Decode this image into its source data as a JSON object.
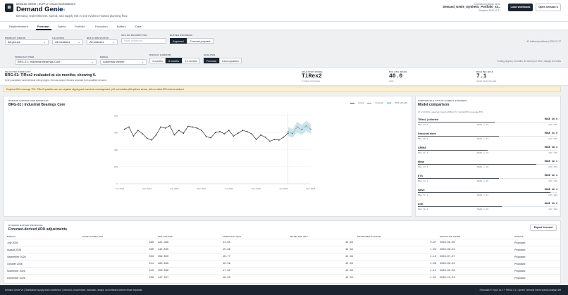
{
  "header": {
    "eyebrow": "DEMAND GENIE | SUPPLY CHAIN WORKBENCH",
    "title": "Demand Genie",
    "version": "VERSION 6",
    "subtitle": "Demand, replenishment, spend, and supply risk in one evidence-based planning flow.",
    "snapshot_label": "Embedded synthetic demo",
    "snapshot_file": "Demand_Genie_Synthetic_Portfolio_v3...",
    "snapshot_date": "Snapshot 2026-07-27",
    "load_button": "Load workbook",
    "open_button": "Open version 4"
  },
  "tabs": [
    "Replenishment",
    "Forecast",
    "Spend",
    "Portfolio",
    "Execution",
    "Buffers",
    "Data"
  ],
  "active_tab": "Forecast",
  "filters": {
    "product_group_label": "PRODUCT GROUP",
    "product_group_value": "All groups",
    "location_label": "LOCATION",
    "location_value": "All locations",
    "netflow_label": "NET-FLOW STATUS",
    "netflow_value": "All statuses",
    "sku_label": "SKU OR DESCRIPTION",
    "sku_placeholder": "Filter positions",
    "buffer_label": "BUFFER ROUNDING",
    "buffer_options": [
      "Approved",
      "Forecast proposal"
    ],
    "buffered_count": "40 buffered positions | 2026-07-27"
  },
  "forecast_controls": {
    "item_label": "FORECAST ITEM",
    "item_value": "BRG-01 | Industrial Bearings Core",
    "model_label": "MODEL",
    "model_value": "Automatic winner",
    "horizon_label": "DISPLAY HORIZON",
    "horizon_options": [
      "3 months",
      "6 months",
      "12 months"
    ],
    "analysis_label": "ANALYSIS",
    "analysis_options": [
      "Forecast",
      "Decomposition"
    ],
    "origins_info": "7 rolling origins | 6 months, 40 series per SKU | display 6 months"
  },
  "selected": {
    "label": "SELECTED FORECAST",
    "headline": "BRG-01: TiRex2 evaluated at six months; showing 6.",
    "detail": "Every candidate used identical rolling origins; forecast output remains separate from qualified demand.",
    "model_label": "SELECTED MODEL",
    "model_value": "TiRex2",
    "model_sub": "7 origins | 40 series",
    "mase_label": "ROLLING MASE",
    "mase_value": "40.0",
    "mase_sub": "units",
    "bias_label": "ROLLING BIAS",
    "bias_value": "7.1",
    "bias_sub": "actual minus forecast"
  },
  "notice": "Empirical 80% coverage 79%. TiRex2 quantiles use non-negative clipping and monotone rearrangement; p10 and median p50 split are shown, with no native 80% interval claimed.",
  "chart_panel": {
    "label": "DEMAND HISTORY AND FORECAST",
    "title": "BRG-01 | Industrial Bearings Core",
    "legend_actual": "Actual",
    "legend_forecast": "Forecast",
    "legend_band": "80% p10-p90"
  },
  "chart_data": {
    "type": "line",
    "title": "BRG-01 | Industrial Bearings Core",
    "xlabel": "",
    "ylabel": "",
    "x_ticks": [
      "Jun 2023",
      "Dec 2023",
      "Jun 2024",
      "Dec 2024",
      "Jun 2025",
      "Dec 2025",
      "Jun 2026",
      "Dec 2026"
    ],
    "y_ticks": [
      0,
      150,
      300,
      450,
      600
    ],
    "ylim": [
      0,
      620
    ],
    "series": [
      {
        "name": "Actual",
        "x": [
          "2023-07",
          "2023-08",
          "2023-09",
          "2023-10",
          "2023-11",
          "2023-12",
          "2024-01",
          "2024-02",
          "2024-03",
          "2024-04",
          "2024-05",
          "2024-06",
          "2024-07",
          "2024-08",
          "2024-09",
          "2024-10",
          "2024-11",
          "2024-12",
          "2025-01",
          "2025-02",
          "2025-03",
          "2025-04",
          "2025-05",
          "2025-06",
          "2025-07",
          "2025-08",
          "2025-09",
          "2025-10",
          "2025-11",
          "2025-12",
          "2026-01",
          "2026-02",
          "2026-03",
          "2026-04",
          "2026-05",
          "2026-06",
          "2026-07"
        ],
        "values": [
          480,
          500,
          420,
          470,
          440,
          400,
          385,
          430,
          500,
          490,
          510,
          430,
          470,
          445,
          505,
          500,
          490,
          470,
          415,
          405,
          450,
          460,
          440,
          470,
          420,
          445,
          470,
          460,
          440,
          390,
          430,
          410,
          375,
          390,
          385,
          410,
          445
        ]
      },
      {
        "name": "Forecast",
        "x": [
          "2026-07",
          "2026-08",
          "2026-09",
          "2026-10",
          "2026-11",
          "2026-12"
        ],
        "values": [
          460,
          442,
          502,
          475,
          510,
          480
        ]
      }
    ],
    "band": {
      "name": "80% p10-p90",
      "x": [
        "2026-07",
        "2026-08",
        "2026-09",
        "2026-10",
        "2026-11",
        "2026-12"
      ],
      "low": [
        420,
        405,
        455,
        430,
        465,
        440
      ],
      "high": [
        500,
        480,
        545,
        520,
        555,
        525
      ]
    }
  },
  "comparison": {
    "label": "COMPARABLE OUT-OF-SAMPLE EVIDENCE",
    "title": "Model comparison",
    "note": "37 of 40 SKUs selected | macro MASE 0.72 | pinball 80% coverage 87%",
    "models": [
      {
        "name": "TiRex2 | selected",
        "mase": "MASE 40.0",
        "fill": 0.55,
        "l1": "MAE 33.8",
        "l2": "MAPE 1.31",
        "l3": "COV 79%"
      },
      {
        "name": "Seasonal naive",
        "mase": "MASE 41.9",
        "fill": 0.58,
        "l1": "MAE 35.9",
        "l2": "MAPE 1.47",
        "l3": "COV 83%"
      },
      {
        "name": "ARIMA",
        "mase": "MASE 38.4",
        "fill": 0.5,
        "l1": "MAE 41.7",
        "l2": "MAPE 1.37",
        "l3": "COV 74%"
      },
      {
        "name": "Mean",
        "mase": "MASE 32.1",
        "fill": 0.85,
        "l1": "MAE 33.5",
        "l2": "MAPE 1.38",
        "l3": "COV 67%"
      },
      {
        "name": "ETS",
        "mase": "MASE 42.4",
        "fill": 0.58,
        "l1": "MAE 73.2",
        "l2": "MAPE 1.45",
        "l3": "COV 71%"
      },
      {
        "name": "Naive",
        "mase": "MASE 42.4",
        "fill": 0.95,
        "l1": "MAE 77.8",
        "l2": "MAPE 1.43",
        "l3": "COV 90%"
      },
      {
        "name": "Drift",
        "mase": "MASE 39.6",
        "fill": 0.6,
        "l1": "MAE 70.4",
        "l2": "MAPE 1.39",
        "l3": "COV 89%"
      }
    ]
  },
  "buffer": {
    "label": "DYNAMIC BUFFER PROPOSAL",
    "title": "Forecast-derived ADU adjustments",
    "export": "Export forecast",
    "columns": [
      "MONTH",
      "POINT FORECAST",
      "80% P10-P90",
      "FORECAST ADU",
      "BASELINE ADU",
      "PROPOSED FACTOR",
      "EFFECTIVE FROM",
      "STATUS"
    ],
    "rows": [
      {
        "month": "July 2026",
        "point": "460",
        "range": "421-489",
        "fadu": "14.85",
        "badu": "15.33",
        "factor": "0.97",
        "eff": "2026-09-30",
        "status": "Proposed"
      },
      {
        "month": "August 2026",
        "point": "490",
        "range": "442-535",
        "fadu": "15.69",
        "badu": "15.33",
        "factor": "1.03",
        "eff": "2026-08-22",
        "status": "Proposed"
      },
      {
        "month": "September 2026",
        "point": "503",
        "range": "459-550",
        "fadu": "16.77",
        "badu": "15.33",
        "factor": "1.10",
        "eff": "2026-07-27",
        "status": "Proposed"
      },
      {
        "month": "October 2026",
        "point": "514",
        "range": "463-569",
        "fadu": "16.59",
        "badu": "15.33",
        "factor": "1.08",
        "eff": "2026-08-23",
        "status": "Proposed"
      },
      {
        "month": "November 2026",
        "point": "510",
        "range": "459-568",
        "fadu": "17.00",
        "badu": "15.33",
        "factor": "1.11",
        "eff": "2026-09-30",
        "status": "Proposed"
      },
      {
        "month": "December 2026",
        "point": "496",
        "range": "447-557",
        "fadu": "16.00",
        "badu": "15.33",
        "factor": "1.04",
        "eff": "2026-10-23",
        "status": "Proposed"
      }
    ]
  },
  "footer": {
    "left": "Demand Genie V6 | Standalone supply chain workbench | Demand, procurement, forecasts, ranges, and released orders remain separate.",
    "right": "Forecasts ® TiyaX 13.4 + TiRex2 0.1 | Speed: Demand Genie special analysis left"
  }
}
